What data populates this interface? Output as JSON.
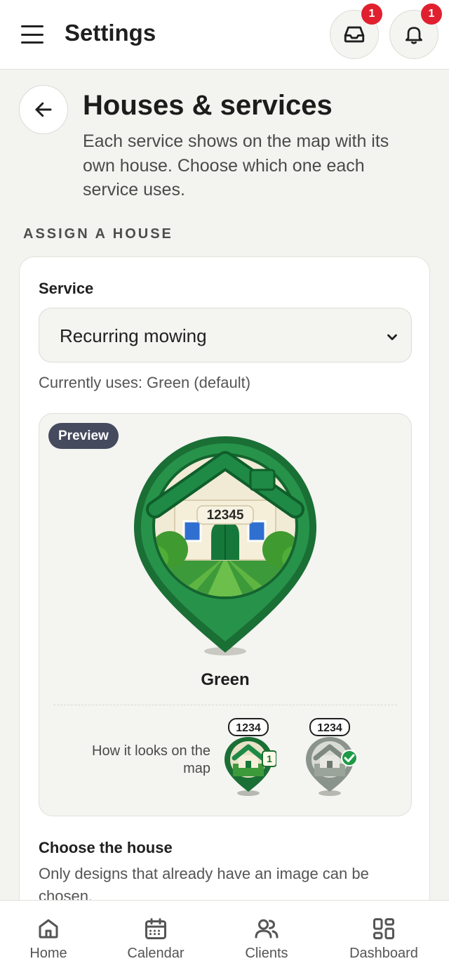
{
  "header": {
    "title": "Settings",
    "inbox_badge": "1",
    "notifications_badge": "1"
  },
  "page": {
    "title": "Houses & services",
    "description": "Each service shows on the map with its own house. Choose which one each service uses.",
    "section_label": "ASSIGN A HOUSE"
  },
  "assign": {
    "service_label": "Service",
    "selected_service": "Recurring mowing",
    "current_text": "Currently uses: Green (default)"
  },
  "preview": {
    "badge": "Preview",
    "house_number": "12345",
    "house_name": "Green",
    "map_label": "How it looks on the map",
    "mini_number": "1234",
    "mini_count": "1"
  },
  "choose": {
    "title": "Choose the house",
    "description": "Only designs that already have an image can be chosen."
  },
  "nav": {
    "items": [
      {
        "label": "Home",
        "icon": "home-icon"
      },
      {
        "label": "Calendar",
        "icon": "calendar-icon"
      },
      {
        "label": "Clients",
        "icon": "clients-icon"
      },
      {
        "label": "Dashboard",
        "icon": "dashboard-icon"
      }
    ]
  },
  "colors": {
    "accent_green": "#1f7a3a",
    "badge_red": "#e0202f",
    "preview_badge": "#454a5e"
  }
}
